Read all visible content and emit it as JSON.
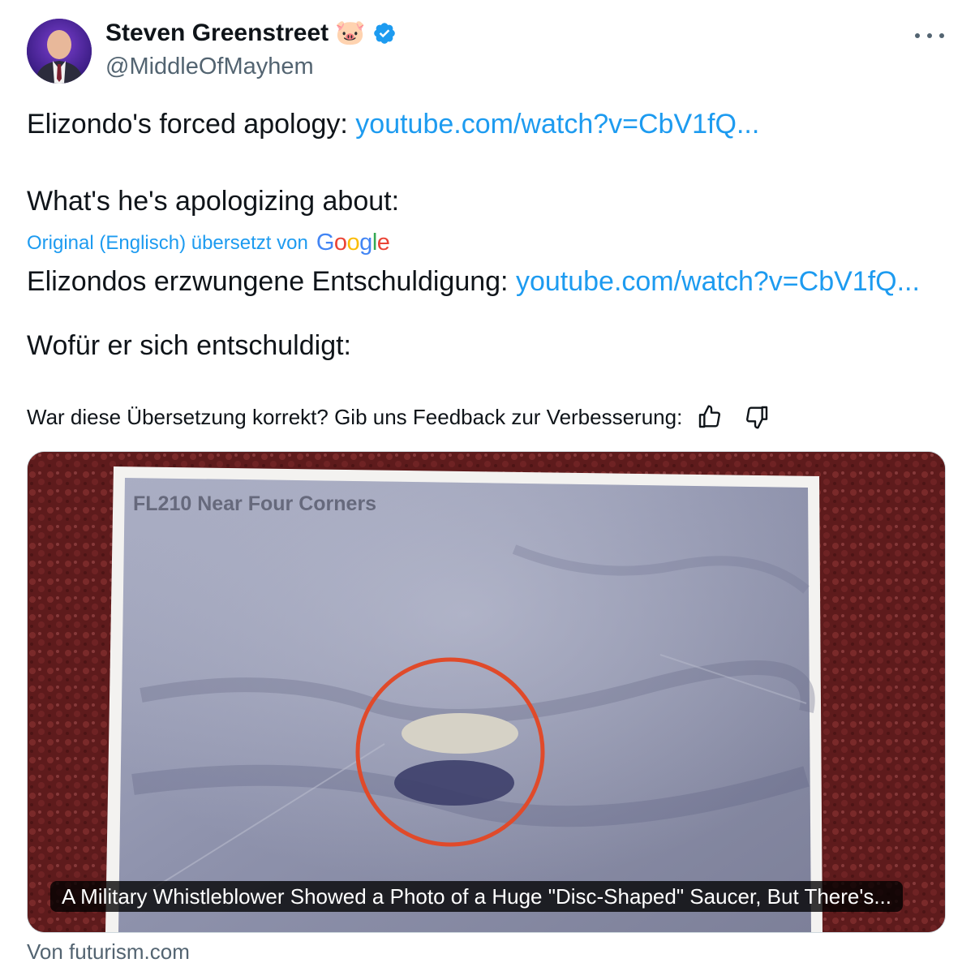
{
  "author": {
    "name": "Steven Greenstreet",
    "name_emoji": "🐷",
    "handle": "@MiddleOfMayhem",
    "verified_icon": "verified-badge-icon",
    "avatar_icon": "avatar"
  },
  "menu": {
    "more_icon": "more-options-icon"
  },
  "tweet": {
    "line1_text": "Elizondo's forced apology: ",
    "line1_link": "youtube.com/watch?v=CbV1fQ...",
    "line2_text": "What's he's apologizing about:"
  },
  "translation": {
    "label": "Original (Englisch) übersetzt von",
    "provider": "Google",
    "line1_text": "Elizondos erzwungene Entschuldigung: ",
    "line1_link": "youtube.com/watch?v=CbV1fQ...",
    "line2_text": "Wofür er sich entschuldigt:",
    "feedback_prompt": "War diese Übersetzung korrekt? Gib uns Feedback zur Verbesserung:",
    "thumbs_up_icon": "thumbs-up-icon",
    "thumbs_down_icon": "thumbs-down-icon"
  },
  "card": {
    "photo_label": "FL210 Near Four Corners",
    "caption": "A Military Whistleblower Showed a Photo of a Huge \"Disc-Shaped\" Saucer, But There's...",
    "source": "Von futurism.com"
  },
  "colors": {
    "link": "#1d9bf0",
    "secondary_text": "#536471",
    "verified": "#1d9bf0",
    "circle_marker": "#e04a2a"
  }
}
